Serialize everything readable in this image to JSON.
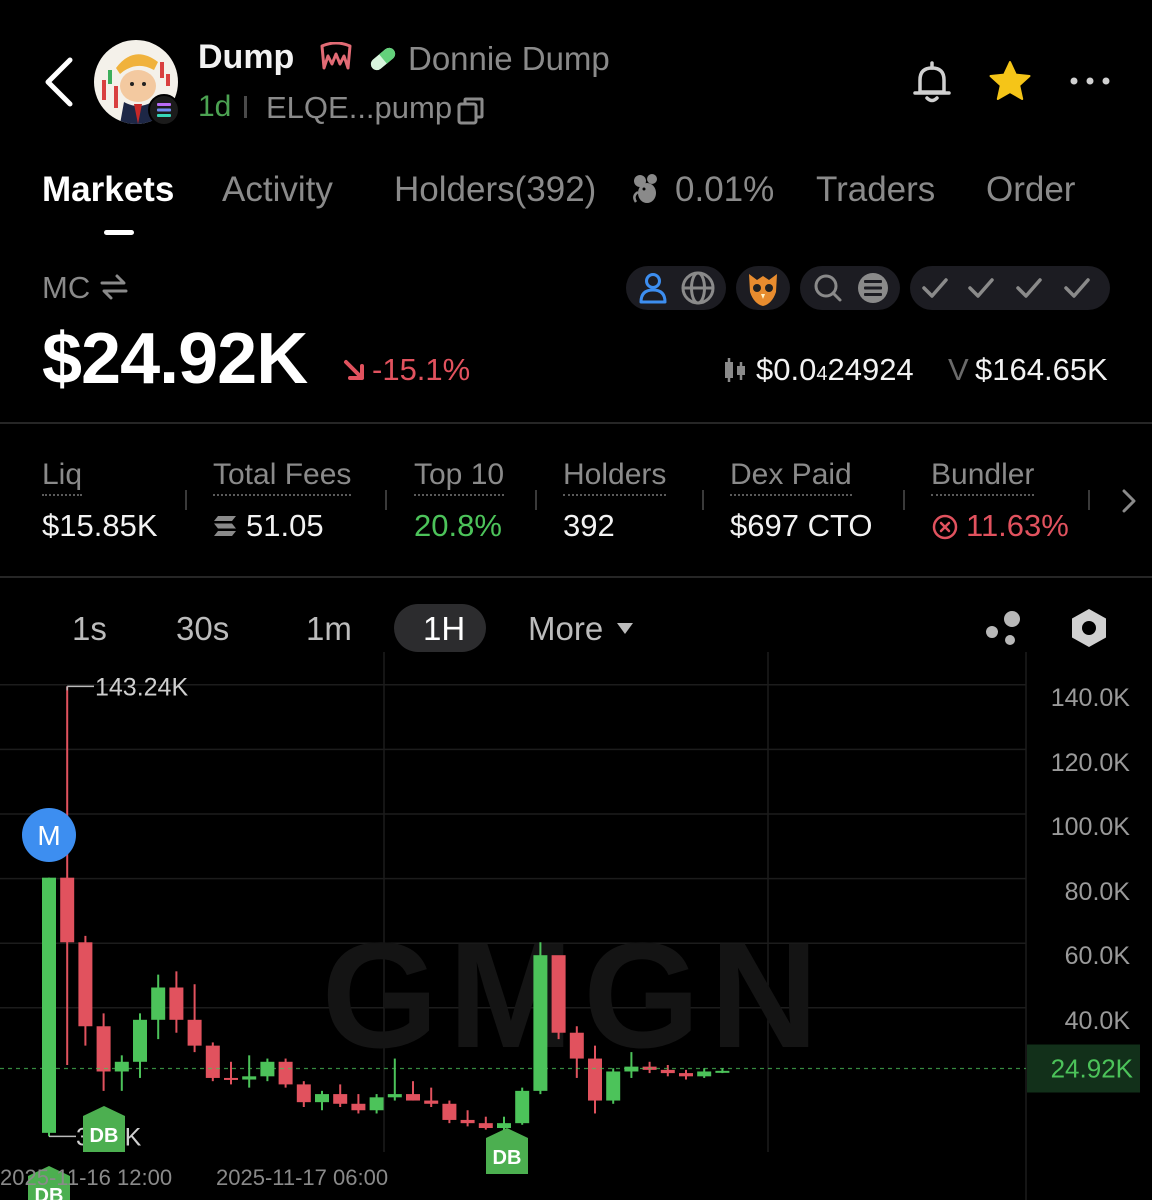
{
  "header": {
    "token_name": "Dump",
    "full_name": "Donnie Dump",
    "age": "1d",
    "address": "ELQE...pump"
  },
  "tabs": [
    {
      "label": "Markets"
    },
    {
      "label": "Activity"
    },
    {
      "label": "Holders(392)"
    },
    {
      "label": "Traders"
    },
    {
      "label": "Order"
    }
  ],
  "tab_holders_extra": "0.01%",
  "market": {
    "mc_label": "MC",
    "mc_value": "$24.92K",
    "mc_change": "-15.1%",
    "price_prefix": "$0.0",
    "price_sub": "4",
    "price_rest": "24924",
    "volume_label": "V",
    "volume_value": "$164.65K"
  },
  "stats": [
    {
      "label": "Liq",
      "value": "$15.85K"
    },
    {
      "label": "Total Fees",
      "value": "51.05"
    },
    {
      "label": "Top 10",
      "value": "20.8%"
    },
    {
      "label": "Holders",
      "value": "392"
    },
    {
      "label": "Dex Paid",
      "value": "$697 CTO"
    },
    {
      "label": "Bundler",
      "value": "11.63%"
    }
  ],
  "timeframes": {
    "items": [
      "1s",
      "30s",
      "1m",
      "1H"
    ],
    "active": "1H",
    "more_label": "More"
  },
  "colors": {
    "up": "#4cc35a",
    "down": "#e1525e",
    "accent_blue": "#3d8ef0",
    "star": "#f5c518"
  },
  "icons": [
    "back-arrow-icon",
    "fangs-icon",
    "pill-icon",
    "copy-icon",
    "bell-icon",
    "star-icon",
    "more-dots-icon",
    "mouse-icon",
    "swap-icon",
    "user-icon",
    "globe-icon",
    "owl-icon",
    "search-icon",
    "solana-icon",
    "check-icon",
    "candle-icon",
    "chevron-right-icon",
    "fees-icon",
    "x-circle-icon",
    "caret-down-icon",
    "indicator-icon",
    "settings-icon"
  ],
  "chart_data": {
    "type": "candlestick",
    "y_ticks": [
      "140.0K",
      "120.0K",
      "100.0K",
      "80.0K",
      "60.0K",
      "40.0K"
    ],
    "ylim": [
      0,
      150000
    ],
    "x_ticks": [
      "2025-11-16 12:00",
      "2025-11-17 06:00"
    ],
    "high_label": "143.24K",
    "low_label": "3.92K",
    "current_label": "24.92K",
    "current_value": 24920,
    "markers": [
      {
        "label": "M",
        "candle": 0
      },
      {
        "label": "DB",
        "candle": 0
      },
      {
        "label": "DB",
        "candle": 3
      },
      {
        "label": "DB",
        "candle": 26
      }
    ],
    "watermark": "GMGN",
    "candles": [
      {
        "o": 5000,
        "h": 84000,
        "l": 3920,
        "c": 84000
      },
      {
        "o": 84000,
        "h": 143240,
        "l": 26000,
        "c": 64000
      },
      {
        "o": 64000,
        "h": 66000,
        "l": 32000,
        "c": 38000
      },
      {
        "o": 38000,
        "h": 42000,
        "l": 18000,
        "c": 24000
      },
      {
        "o": 24000,
        "h": 29000,
        "l": 18000,
        "c": 27000
      },
      {
        "o": 27000,
        "h": 42000,
        "l": 22000,
        "c": 40000
      },
      {
        "o": 40000,
        "h": 54000,
        "l": 34000,
        "c": 50000
      },
      {
        "o": 50000,
        "h": 55000,
        "l": 36000,
        "c": 40000
      },
      {
        "o": 40000,
        "h": 51000,
        "l": 30000,
        "c": 32000
      },
      {
        "o": 32000,
        "h": 33000,
        "l": 21000,
        "c": 22000
      },
      {
        "o": 22000,
        "h": 27000,
        "l": 20000,
        "c": 21500
      },
      {
        "o": 21500,
        "h": 29000,
        "l": 19000,
        "c": 22500
      },
      {
        "o": 22500,
        "h": 28000,
        "l": 21000,
        "c": 27000
      },
      {
        "o": 27000,
        "h": 28000,
        "l": 19000,
        "c": 20000
      },
      {
        "o": 20000,
        "h": 21000,
        "l": 13000,
        "c": 14500
      },
      {
        "o": 14500,
        "h": 18000,
        "l": 12000,
        "c": 17000
      },
      {
        "o": 17000,
        "h": 20000,
        "l": 13000,
        "c": 14000
      },
      {
        "o": 14000,
        "h": 17000,
        "l": 11000,
        "c": 12000
      },
      {
        "o": 12000,
        "h": 17000,
        "l": 11000,
        "c": 16000
      },
      {
        "o": 16000,
        "h": 28000,
        "l": 15000,
        "c": 17000
      },
      {
        "o": 17000,
        "h": 21000,
        "l": 15000,
        "c": 15000
      },
      {
        "o": 15000,
        "h": 19000,
        "l": 13000,
        "c": 14000
      },
      {
        "o": 14000,
        "h": 15000,
        "l": 8000,
        "c": 9000
      },
      {
        "o": 9000,
        "h": 12000,
        "l": 7000,
        "c": 8000
      },
      {
        "o": 8000,
        "h": 10000,
        "l": 6000,
        "c": 6500
      },
      {
        "o": 6500,
        "h": 10000,
        "l": 5500,
        "c": 8000
      },
      {
        "o": 8000,
        "h": 19000,
        "l": 7500,
        "c": 18000
      },
      {
        "o": 18000,
        "h": 64000,
        "l": 17000,
        "c": 60000
      },
      {
        "o": 60000,
        "h": 59000,
        "l": 34000,
        "c": 36000
      },
      {
        "o": 36000,
        "h": 38000,
        "l": 22000,
        "c": 28000
      },
      {
        "o": 28000,
        "h": 32000,
        "l": 11000,
        "c": 15000
      },
      {
        "o": 15000,
        "h": 25000,
        "l": 14000,
        "c": 24000
      },
      {
        "o": 24000,
        "h": 30000,
        "l": 22000,
        "c": 25500
      },
      {
        "o": 25500,
        "h": 27000,
        "l": 23500,
        "c": 24500
      },
      {
        "o": 24500,
        "h": 26000,
        "l": 22500,
        "c": 23500
      },
      {
        "o": 23500,
        "h": 24500,
        "l": 21500,
        "c": 22500
      },
      {
        "o": 22500,
        "h": 25000,
        "l": 22000,
        "c": 24000
      },
      {
        "o": 24000,
        "h": 25000,
        "l": 23500,
        "c": 24200
      }
    ]
  }
}
